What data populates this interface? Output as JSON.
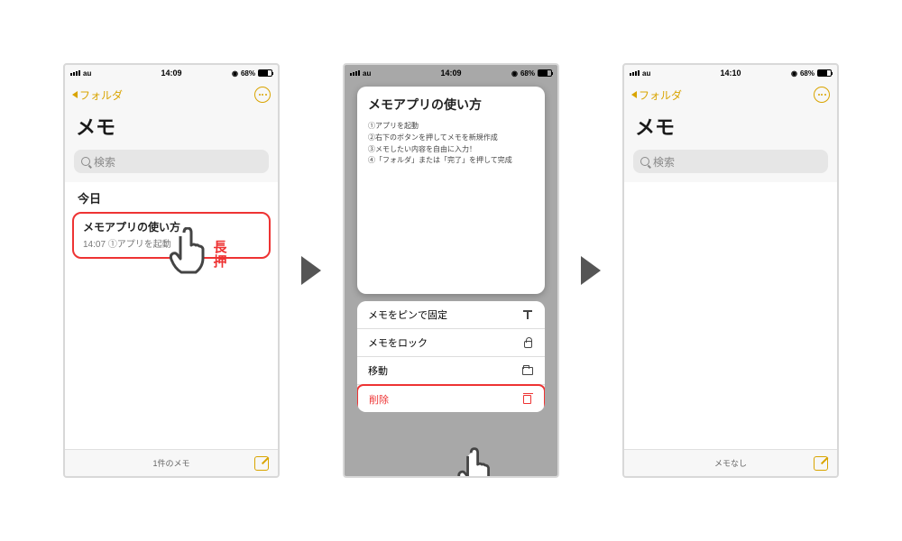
{
  "statusbar": {
    "carrier": "au",
    "battery_pct": "68%",
    "recording": "◉"
  },
  "screen1": {
    "time": "14:09",
    "back_label": "フォルダ",
    "title": "メモ",
    "search_placeholder": "検索",
    "section": "今日",
    "note_title": "メモアプリの使い方",
    "note_time": "14:07",
    "note_preview": "①アプリを起動",
    "footer": "1件のメモ",
    "annotation": "長押"
  },
  "screen2": {
    "time": "14:09",
    "preview_title": "メモアプリの使い方",
    "preview_lines": [
      "①アプリを起動",
      "②右下のボタンを押してメモを新規作成",
      "③メモしたい内容を自由に入力！",
      "④「フォルダ」または「完了」を押して完成"
    ],
    "menu": {
      "pin": "メモをピンで固定",
      "lock": "メモをロック",
      "move": "移動",
      "delete": "削除"
    }
  },
  "screen3": {
    "time": "14:10",
    "back_label": "フォルダ",
    "title": "メモ",
    "search_placeholder": "検索",
    "footer": "メモなし"
  }
}
